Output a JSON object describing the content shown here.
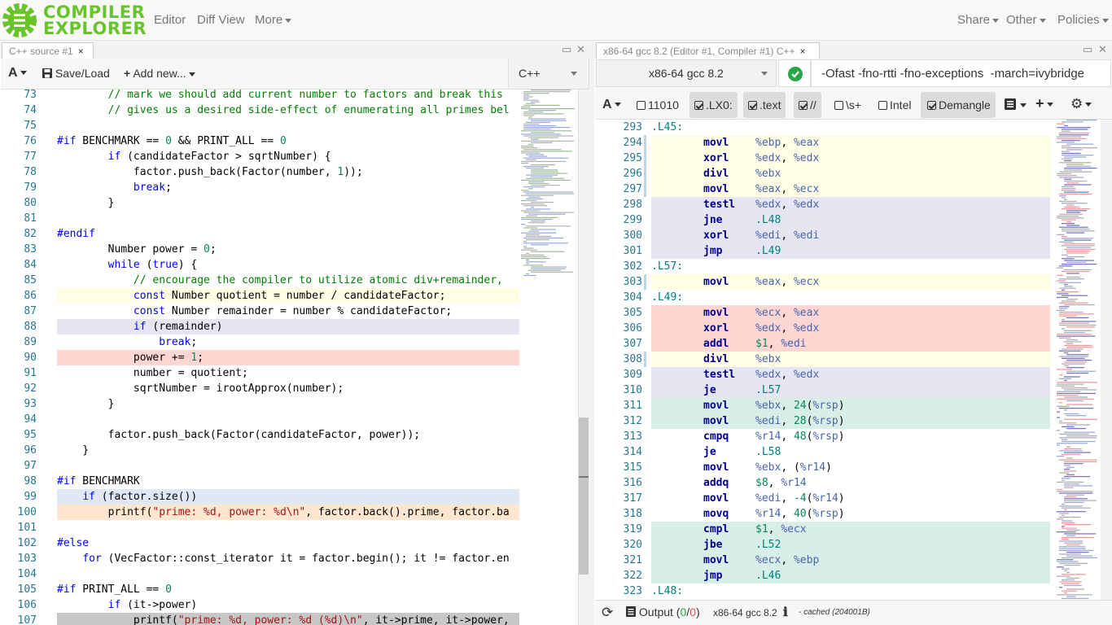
{
  "nav": {
    "logo_line1": "COMPILER",
    "logo_line2": "EXPLORER",
    "editor": "Editor",
    "diff_view": "Diff View",
    "more": "More",
    "share": "Share",
    "other": "Other",
    "policies": "Policies"
  },
  "source_pane": {
    "tab_label": "C++ source #1",
    "tab_close": "×",
    "font_button": "A",
    "save_load": "Save/Load",
    "add_new": "Add new...",
    "language": "C++",
    "lines": [
      {
        "n": "73",
        "hl": "",
        "tokens": [
          {
            "t": "        ",
            "c": ""
          },
          {
            "t": "// mark we should add current number to factors and break this",
            "c": "cm"
          }
        ]
      },
      {
        "n": "74",
        "hl": "",
        "tokens": [
          {
            "t": "        ",
            "c": ""
          },
          {
            "t": "// gives us a desired side-effect of enumerating all primes bel",
            "c": "cm"
          }
        ]
      },
      {
        "n": "75",
        "hl": "",
        "tokens": []
      },
      {
        "n": "76",
        "hl": "",
        "tokens": [
          {
            "t": "#if",
            "c": "pp"
          },
          {
            "t": " BENCHMARK == ",
            "c": ""
          },
          {
            "t": "0",
            "c": "nm"
          },
          {
            "t": " && PRINT_ALL == ",
            "c": ""
          },
          {
            "t": "0",
            "c": "nm"
          }
        ]
      },
      {
        "n": "77",
        "hl": "",
        "tokens": [
          {
            "t": "        ",
            "c": ""
          },
          {
            "t": "if",
            "c": "kw"
          },
          {
            "t": " (candidateFactor > sqrtNumber) {",
            "c": ""
          }
        ]
      },
      {
        "n": "78",
        "hl": "",
        "tokens": [
          {
            "t": "            factor.push_back(Factor(number, ",
            "c": ""
          },
          {
            "t": "1",
            "c": "nm"
          },
          {
            "t": "));",
            "c": ""
          }
        ]
      },
      {
        "n": "79",
        "hl": "",
        "tokens": [
          {
            "t": "            ",
            "c": ""
          },
          {
            "t": "break",
            "c": "kw"
          },
          {
            "t": ";",
            "c": ""
          }
        ]
      },
      {
        "n": "80",
        "hl": "",
        "tokens": [
          {
            "t": "        }",
            "c": ""
          }
        ]
      },
      {
        "n": "81",
        "hl": "",
        "tokens": []
      },
      {
        "n": "82",
        "hl": "",
        "tokens": [
          {
            "t": "#endif",
            "c": "pp"
          }
        ]
      },
      {
        "n": "83",
        "hl": "",
        "tokens": [
          {
            "t": "        Number power = ",
            "c": ""
          },
          {
            "t": "0",
            "c": "nm"
          },
          {
            "t": ";",
            "c": ""
          }
        ]
      },
      {
        "n": "84",
        "hl": "",
        "tokens": [
          {
            "t": "        ",
            "c": ""
          },
          {
            "t": "while",
            "c": "kw"
          },
          {
            "t": " (",
            "c": ""
          },
          {
            "t": "true",
            "c": "kw"
          },
          {
            "t": ") {",
            "c": ""
          }
        ]
      },
      {
        "n": "85",
        "hl": "",
        "tokens": [
          {
            "t": "            ",
            "c": ""
          },
          {
            "t": "// encourage the compiler to utilize atomic div+remainder,",
            "c": "cm"
          }
        ]
      },
      {
        "n": "86",
        "hl": "yellow",
        "tokens": [
          {
            "t": "            ",
            "c": ""
          },
          {
            "t": "const",
            "c": "kw"
          },
          {
            "t": " Number quotient = number / candidateFactor;",
            "c": ""
          }
        ]
      },
      {
        "n": "87",
        "hl": "",
        "tokens": [
          {
            "t": "            ",
            "c": ""
          },
          {
            "t": "const",
            "c": "kw"
          },
          {
            "t": " Number remainder = number % candidateFactor;",
            "c": ""
          }
        ]
      },
      {
        "n": "88",
        "hl": "purple",
        "tokens": [
          {
            "t": "            ",
            "c": ""
          },
          {
            "t": "if",
            "c": "kw"
          },
          {
            "t": " (remainder)",
            "c": ""
          }
        ]
      },
      {
        "n": "89",
        "hl": "",
        "tokens": [
          {
            "t": "                ",
            "c": ""
          },
          {
            "t": "break",
            "c": "kw"
          },
          {
            "t": ";",
            "c": ""
          }
        ]
      },
      {
        "n": "90",
        "hl": "red",
        "tokens": [
          {
            "t": "            power += ",
            "c": ""
          },
          {
            "t": "1",
            "c": "nm"
          },
          {
            "t": ";",
            "c": ""
          }
        ]
      },
      {
        "n": "91",
        "hl": "",
        "tokens": [
          {
            "t": "            number = quotient;",
            "c": ""
          }
        ]
      },
      {
        "n": "92",
        "hl": "",
        "tokens": [
          {
            "t": "            sqrtNumber = irootApprox(number);",
            "c": ""
          }
        ]
      },
      {
        "n": "93",
        "hl": "",
        "tokens": [
          {
            "t": "        }",
            "c": ""
          }
        ]
      },
      {
        "n": "94",
        "hl": "",
        "tokens": []
      },
      {
        "n": "95",
        "hl": "",
        "tokens": [
          {
            "t": "        factor.push_back(Factor(candidateFactor, power));",
            "c": ""
          }
        ]
      },
      {
        "n": "96",
        "hl": "",
        "tokens": [
          {
            "t": "    }",
            "c": ""
          }
        ]
      },
      {
        "n": "97",
        "hl": "",
        "tokens": []
      },
      {
        "n": "98",
        "hl": "",
        "tokens": [
          {
            "t": "#if",
            "c": "pp"
          },
          {
            "t": " BENCHMARK",
            "c": ""
          }
        ]
      },
      {
        "n": "99",
        "hl": "blue",
        "tokens": [
          {
            "t": "    ",
            "c": ""
          },
          {
            "t": "if",
            "c": "kw"
          },
          {
            "t": " (factor.size())",
            "c": ""
          }
        ]
      },
      {
        "n": "100",
        "hl": "orange",
        "tokens": [
          {
            "t": "        printf(",
            "c": ""
          },
          {
            "t": "\"prime: %d, power: %d\\n\"",
            "c": "st"
          },
          {
            "t": ", factor.back().prime, factor.ba",
            "c": ""
          }
        ]
      },
      {
        "n": "101",
        "hl": "",
        "tokens": []
      },
      {
        "n": "102",
        "hl": "",
        "tokens": [
          {
            "t": "#else",
            "c": "pp"
          }
        ]
      },
      {
        "n": "103",
        "hl": "",
        "tokens": [
          {
            "t": "    ",
            "c": ""
          },
          {
            "t": "for",
            "c": "kw"
          },
          {
            "t": " (VecFactor::const_iterator it = factor.begin(); it != factor.en",
            "c": ""
          }
        ]
      },
      {
        "n": "104",
        "hl": "",
        "tokens": []
      },
      {
        "n": "105",
        "hl": "",
        "tokens": [
          {
            "t": "#if",
            "c": "pp"
          },
          {
            "t": " PRINT_ALL == ",
            "c": ""
          },
          {
            "t": "0",
            "c": "nm"
          }
        ]
      },
      {
        "n": "106",
        "hl": "",
        "tokens": [
          {
            "t": "        ",
            "c": ""
          },
          {
            "t": "if",
            "c": "kw"
          },
          {
            "t": " (it->power)",
            "c": ""
          }
        ]
      },
      {
        "n": "107",
        "hl": "gray",
        "tokens": [
          {
            "t": "            printf(",
            "c": ""
          },
          {
            "t": "\"prime: %d, power: %d (%d)\\n\"",
            "c": "st"
          },
          {
            "t": ", it->prime, it->power,",
            "c": ""
          }
        ]
      }
    ]
  },
  "asm_pane": {
    "tab_label": "x86-64 gcc 8.2 (Editor #1, Compiler #1) C++",
    "tab_close": "×",
    "compiler": "x86-64 gcc 8.2",
    "options": "-Ofast -fno-rtti -fno-exceptions  -march=ivybridge",
    "filters": {
      "font": "A",
      "binary": "11010",
      "lx0": ".LX0:",
      "text": ".text",
      "comments": "//",
      "whitespace": "\\s+",
      "intel": "Intel",
      "demangle": "Demangle"
    },
    "lines": [
      {
        "n": "293",
        "hl": "",
        "label": ".L45:",
        "op": "",
        "args": []
      },
      {
        "n": "294",
        "hl": "yellow",
        "label": "",
        "op": "movl",
        "args": [
          {
            "t": "%ebp",
            "c": "reg"
          },
          {
            "t": ", ",
            "c": ""
          },
          {
            "t": "%eax",
            "c": "reg"
          }
        ]
      },
      {
        "n": "295",
        "hl": "yellow",
        "label": "",
        "op": "xorl",
        "args": [
          {
            "t": "%edx",
            "c": "reg"
          },
          {
            "t": ", ",
            "c": ""
          },
          {
            "t": "%edx",
            "c": "reg"
          }
        ]
      },
      {
        "n": "296",
        "hl": "yellow",
        "label": "",
        "op": "divl",
        "args": [
          {
            "t": "%ebx",
            "c": "reg"
          }
        ]
      },
      {
        "n": "297",
        "hl": "yellow",
        "label": "",
        "op": "movl",
        "args": [
          {
            "t": "%eax",
            "c": "reg"
          },
          {
            "t": ", ",
            "c": ""
          },
          {
            "t": "%ecx",
            "c": "reg"
          }
        ]
      },
      {
        "n": "298",
        "hl": "purple",
        "label": "",
        "op": "testl",
        "args": [
          {
            "t": "%edx",
            "c": "reg"
          },
          {
            "t": ", ",
            "c": ""
          },
          {
            "t": "%edx",
            "c": "reg"
          }
        ]
      },
      {
        "n": "299",
        "hl": "purple",
        "label": "",
        "op": "jne",
        "args": [
          {
            "t": ".L48",
            "c": "lbl"
          }
        ]
      },
      {
        "n": "300",
        "hl": "purple",
        "label": "",
        "op": "xorl",
        "args": [
          {
            "t": "%edi",
            "c": "reg"
          },
          {
            "t": ", ",
            "c": ""
          },
          {
            "t": "%edi",
            "c": "reg"
          }
        ]
      },
      {
        "n": "301",
        "hl": "purple",
        "label": "",
        "op": "jmp",
        "args": [
          {
            "t": ".L49",
            "c": "lbl"
          }
        ]
      },
      {
        "n": "302",
        "hl": "",
        "label": ".L57:",
        "op": "",
        "args": []
      },
      {
        "n": "303",
        "hl": "yellow",
        "label": "",
        "op": "movl",
        "args": [
          {
            "t": "%eax",
            "c": "reg"
          },
          {
            "t": ", ",
            "c": ""
          },
          {
            "t": "%ecx",
            "c": "reg"
          }
        ]
      },
      {
        "n": "304",
        "hl": "",
        "label": ".L49:",
        "op": "",
        "args": []
      },
      {
        "n": "305",
        "hl": "red",
        "label": "",
        "op": "movl",
        "args": [
          {
            "t": "%ecx",
            "c": "reg"
          },
          {
            "t": ", ",
            "c": ""
          },
          {
            "t": "%eax",
            "c": "reg"
          }
        ]
      },
      {
        "n": "306",
        "hl": "red",
        "label": "",
        "op": "xorl",
        "args": [
          {
            "t": "%edx",
            "c": "reg"
          },
          {
            "t": ", ",
            "c": ""
          },
          {
            "t": "%edx",
            "c": "reg"
          }
        ]
      },
      {
        "n": "307",
        "hl": "red",
        "label": "",
        "op": "addl",
        "args": [
          {
            "t": "$1",
            "c": "num"
          },
          {
            "t": ", ",
            "c": ""
          },
          {
            "t": "%edi",
            "c": "reg"
          }
        ]
      },
      {
        "n": "308",
        "hl": "yellow",
        "label": "",
        "op": "divl",
        "args": [
          {
            "t": "%ebx",
            "c": "reg"
          }
        ]
      },
      {
        "n": "309",
        "hl": "purple",
        "label": "",
        "op": "testl",
        "args": [
          {
            "t": "%edx",
            "c": "reg"
          },
          {
            "t": ", ",
            "c": ""
          },
          {
            "t": "%edx",
            "c": "reg"
          }
        ]
      },
      {
        "n": "310",
        "hl": "purple",
        "label": "",
        "op": "je",
        "args": [
          {
            "t": ".L57",
            "c": "lbl"
          }
        ]
      },
      {
        "n": "311",
        "hl": "green",
        "label": "",
        "op": "movl",
        "args": [
          {
            "t": "%ebx",
            "c": "reg"
          },
          {
            "t": ", ",
            "c": ""
          },
          {
            "t": "24",
            "c": "num"
          },
          {
            "t": "(",
            "c": ""
          },
          {
            "t": "%rsp",
            "c": "reg"
          },
          {
            "t": ")",
            "c": ""
          }
        ]
      },
      {
        "n": "312",
        "hl": "green",
        "label": "",
        "op": "movl",
        "args": [
          {
            "t": "%edi",
            "c": "reg"
          },
          {
            "t": ", ",
            "c": ""
          },
          {
            "t": "28",
            "c": "num"
          },
          {
            "t": "(",
            "c": ""
          },
          {
            "t": "%rsp",
            "c": "reg"
          },
          {
            "t": ")",
            "c": ""
          }
        ]
      },
      {
        "n": "313",
        "hl": "",
        "label": "",
        "op": "cmpq",
        "args": [
          {
            "t": "%r14",
            "c": "reg"
          },
          {
            "t": ", ",
            "c": ""
          },
          {
            "t": "48",
            "c": "num"
          },
          {
            "t": "(",
            "c": ""
          },
          {
            "t": "%rsp",
            "c": "reg"
          },
          {
            "t": ")",
            "c": ""
          }
        ]
      },
      {
        "n": "314",
        "hl": "",
        "label": "",
        "op": "je",
        "args": [
          {
            "t": ".L58",
            "c": "lbl"
          }
        ]
      },
      {
        "n": "315",
        "hl": "",
        "label": "",
        "op": "movl",
        "args": [
          {
            "t": "%ebx",
            "c": "reg"
          },
          {
            "t": ", (",
            "c": ""
          },
          {
            "t": "%r14",
            "c": "reg"
          },
          {
            "t": ")",
            "c": ""
          }
        ]
      },
      {
        "n": "316",
        "hl": "",
        "label": "",
        "op": "addq",
        "args": [
          {
            "t": "$8",
            "c": "num"
          },
          {
            "t": ", ",
            "c": ""
          },
          {
            "t": "%r14",
            "c": "reg"
          }
        ]
      },
      {
        "n": "317",
        "hl": "",
        "label": "",
        "op": "movl",
        "args": [
          {
            "t": "%edi",
            "c": "reg"
          },
          {
            "t": ", ",
            "c": ""
          },
          {
            "t": "-4",
            "c": "num"
          },
          {
            "t": "(",
            "c": ""
          },
          {
            "t": "%r14",
            "c": "reg"
          },
          {
            "t": ")",
            "c": ""
          }
        ]
      },
      {
        "n": "318",
        "hl": "",
        "label": "",
        "op": "movq",
        "args": [
          {
            "t": "%r14",
            "c": "reg"
          },
          {
            "t": ", ",
            "c": ""
          },
          {
            "t": "40",
            "c": "num"
          },
          {
            "t": "(",
            "c": ""
          },
          {
            "t": "%rsp",
            "c": "reg"
          },
          {
            "t": ")",
            "c": ""
          }
        ]
      },
      {
        "n": "319",
        "hl": "green",
        "label": "",
        "op": "cmpl",
        "args": [
          {
            "t": "$1",
            "c": "num"
          },
          {
            "t": ", ",
            "c": ""
          },
          {
            "t": "%ecx",
            "c": "reg"
          }
        ]
      },
      {
        "n": "320",
        "hl": "green",
        "label": "",
        "op": "jbe",
        "args": [
          {
            "t": ".L52",
            "c": "lbl"
          }
        ]
      },
      {
        "n": "321",
        "hl": "green",
        "label": "",
        "op": "movl",
        "args": [
          {
            "t": "%ecx",
            "c": "reg"
          },
          {
            "t": ", ",
            "c": ""
          },
          {
            "t": "%ebp",
            "c": "reg"
          }
        ]
      },
      {
        "n": "322",
        "hl": "green",
        "label": "",
        "op": "jmp",
        "args": [
          {
            "t": ".L46",
            "c": "lbl"
          }
        ]
      },
      {
        "n": "323",
        "hl": "",
        "label": ".L48:",
        "op": "",
        "args": []
      }
    ],
    "status": {
      "output_label": "Output (",
      "output_ok": "0",
      "output_sep": "/",
      "output_err": "0",
      "output_close": ")",
      "compiler_name": "x86-64 gcc 8.2",
      "cached": "- cached (204001B)"
    }
  },
  "colors": {
    "brand": "#67c52a",
    "success": "#28a745"
  }
}
